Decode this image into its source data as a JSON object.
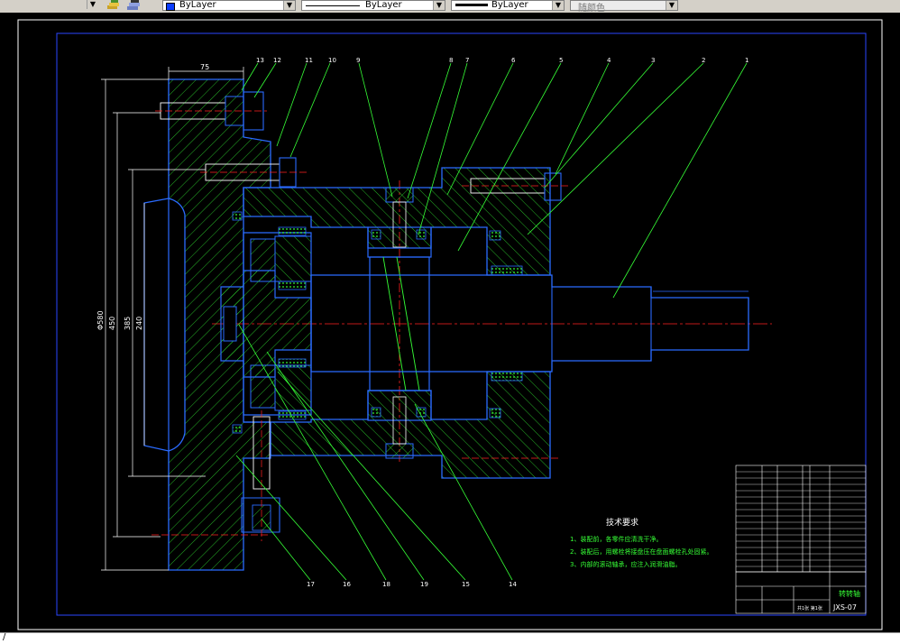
{
  "toolbar": {
    "layer_combo": "ByLayer",
    "linetype_combo": "ByLayer",
    "lineweight_combo": "ByLayer",
    "color_combo": "随颜色"
  },
  "drawing": {
    "dims": {
      "top_width": "75",
      "d1": "Φ580",
      "d2": "450",
      "d3": "385",
      "d4": "240"
    },
    "leaders_top": [
      "13",
      "12",
      "11",
      "10",
      "9",
      "8",
      "7",
      "6",
      "5",
      "4",
      "3",
      "2",
      "1"
    ],
    "leaders_bottom": [
      "17",
      "16",
      "18",
      "19",
      "15",
      "14"
    ],
    "notes": {
      "title": "技术要求",
      "items": [
        "1、装配前，各零件应清洗干净。",
        "2、装配后，用螺栓将接盘压在盘面螺栓孔处固紧。",
        "3、内部的滚动轴承，应注入润滑油脂。"
      ]
    },
    "title_block": {
      "part_name": "转转轴",
      "drawing_no": "JXS-07",
      "sheet": "共1张  第1张"
    }
  },
  "command": {
    "prompt": "/"
  }
}
